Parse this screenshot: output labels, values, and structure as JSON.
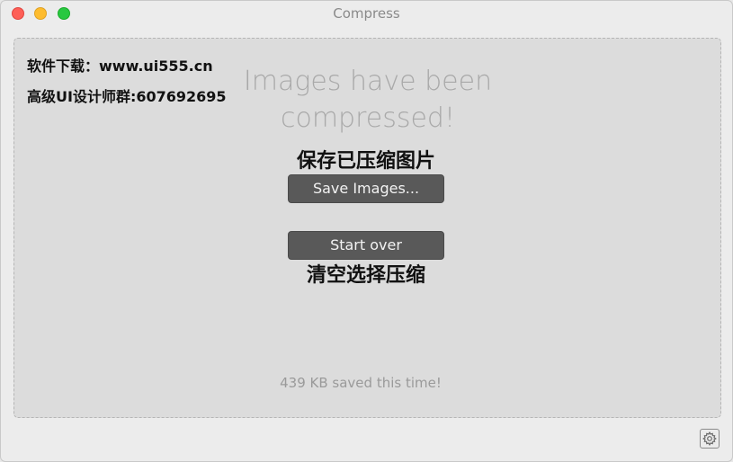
{
  "window": {
    "title": "Compress",
    "controls": {
      "close": "close-button",
      "minimize": "minimize-button",
      "maximize": "zoom-button"
    }
  },
  "overlay": {
    "line1": "软件下载：www.ui555.cn",
    "line2": "高级UI设计师群:607692695"
  },
  "main": {
    "headline": "Images have been compressed!",
    "save_caption": "保存已压缩图片",
    "save_button": "Save Images...",
    "start_over_button": "Start over",
    "start_over_caption": "清空选择压缩",
    "status": "439 KB saved this time!"
  },
  "footer": {
    "settings_icon": "gear-icon"
  },
  "colors": {
    "button_bg": "#595959",
    "dropzone_bg": "#dcdcdc",
    "close": "#fe5f57",
    "minimize": "#febc2e",
    "zoom": "#28c840"
  }
}
